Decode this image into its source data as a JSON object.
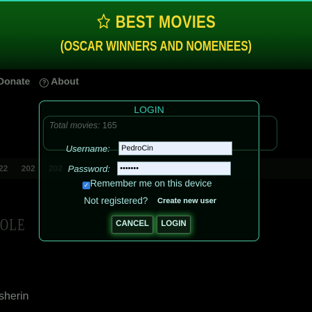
{
  "header": {
    "title": "BEST MOVIES",
    "subtitle": "(OSCAR WINNERS AND NOMENEES)",
    "accent_color": "#f2d92e",
    "icon": "star-outline-icon"
  },
  "nav": {
    "donate": "Donate",
    "about": "About",
    "about_icon": "question-circle-icon"
  },
  "background": {
    "years": [
      "22",
      "202",
      "202"
    ],
    "partial_text_1": "OLE",
    "partial_text_2": "sherin"
  },
  "login_modal": {
    "title": "LOGIN",
    "total_movies_label": "Total movies:",
    "total_movies_value": "165",
    "username_label": "Username:",
    "username_value": "PedroCin",
    "password_label": "Password:",
    "password_value": "•••••••",
    "remember_label": "Remember me on this device",
    "remember_checked": true,
    "not_registered": "Not registered?",
    "create_user": "Create new user",
    "cancel_label": "CANCEL",
    "login_label": "LOGIN"
  }
}
